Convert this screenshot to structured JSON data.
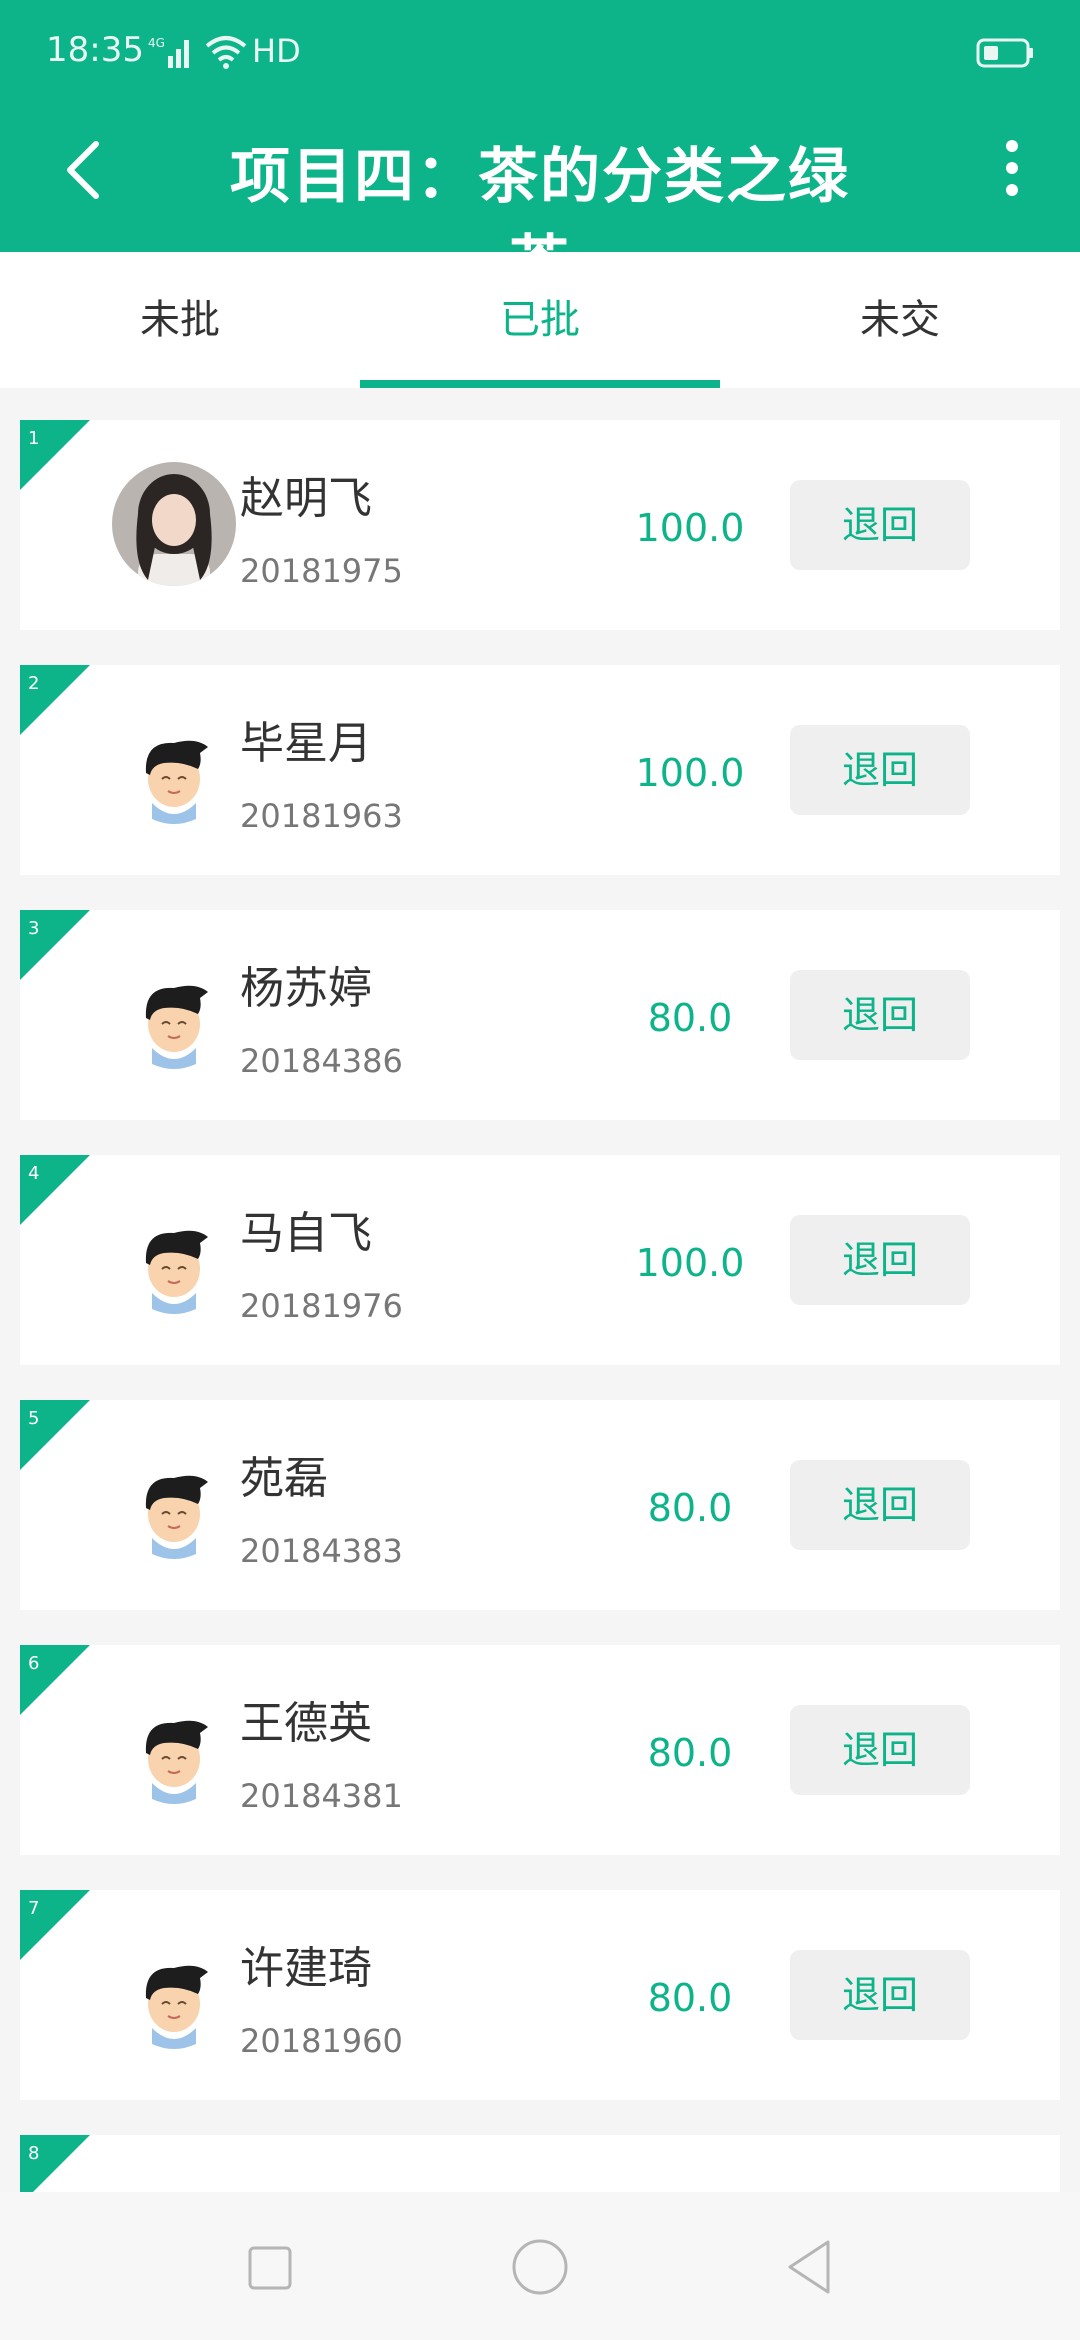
{
  "status": {
    "time": "18:35",
    "network": "4G",
    "hd": "HD"
  },
  "header": {
    "title": "项目四：茶的分类之绿茶",
    "back_icon": "chevron-left-icon",
    "more_icon": "more-vertical-icon"
  },
  "tabs": [
    {
      "label": "未批",
      "active": false
    },
    {
      "label": "已批",
      "active": true
    },
    {
      "label": "未交",
      "active": false
    }
  ],
  "colors": {
    "primary": "#0db389",
    "button_bg": "#efefef"
  },
  "students": [
    {
      "index": "1",
      "name": "赵明飞",
      "id": "20181975",
      "score": "100.0",
      "action": "退回",
      "avatar": "photo"
    },
    {
      "index": "2",
      "name": "毕星月",
      "id": "20181963",
      "score": "100.0",
      "action": "退回",
      "avatar": "cartoon"
    },
    {
      "index": "3",
      "name": "杨苏婷",
      "id": "20184386",
      "score": "80.0",
      "action": "退回",
      "avatar": "cartoon"
    },
    {
      "index": "4",
      "name": "马自飞",
      "id": "20181976",
      "score": "100.0",
      "action": "退回",
      "avatar": "cartoon"
    },
    {
      "index": "5",
      "name": "苑磊",
      "id": "20184383",
      "score": "80.0",
      "action": "退回",
      "avatar": "cartoon"
    },
    {
      "index": "6",
      "name": "王德英",
      "id": "20184381",
      "score": "80.0",
      "action": "退回",
      "avatar": "cartoon"
    },
    {
      "index": "7",
      "name": "许建琦",
      "id": "20181960",
      "score": "80.0",
      "action": "退回",
      "avatar": "cartoon"
    },
    {
      "index": "8",
      "name": "",
      "id": "",
      "score": "",
      "action": "",
      "avatar": "cartoon"
    }
  ],
  "nav": {
    "recents_icon": "square-icon",
    "home_icon": "circle-icon",
    "back_icon": "triangle-back-icon"
  }
}
